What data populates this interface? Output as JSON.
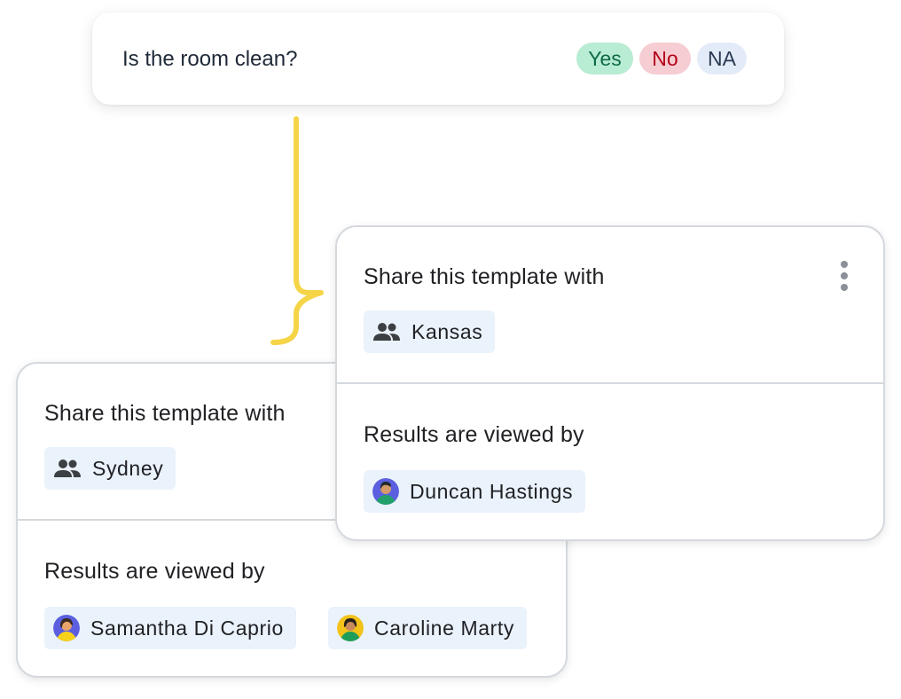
{
  "question": {
    "text": "Is the room clean?",
    "answers": [
      "Yes",
      "No",
      "NA"
    ]
  },
  "cards": {
    "sydney": {
      "share_title": "Share this template with",
      "share_chip": "Sydney",
      "results_title": "Results are viewed by",
      "viewers": [
        "Samantha Di Caprio",
        "Caroline Marty"
      ]
    },
    "kansas": {
      "share_title": "Share this template with",
      "share_chip": "Kansas",
      "results_title": "Results are viewed by",
      "viewers": [
        "Duncan Hastings"
      ]
    }
  },
  "colors": {
    "connector": "#f5d547",
    "yes_bg": "#b8ecd3",
    "no_bg": "#f6cdd2",
    "na_bg": "#e4ebf8",
    "chip_bg": "#eaf2fb"
  },
  "icons": {
    "group": "group-icon",
    "more": "more-vertical-icon"
  }
}
